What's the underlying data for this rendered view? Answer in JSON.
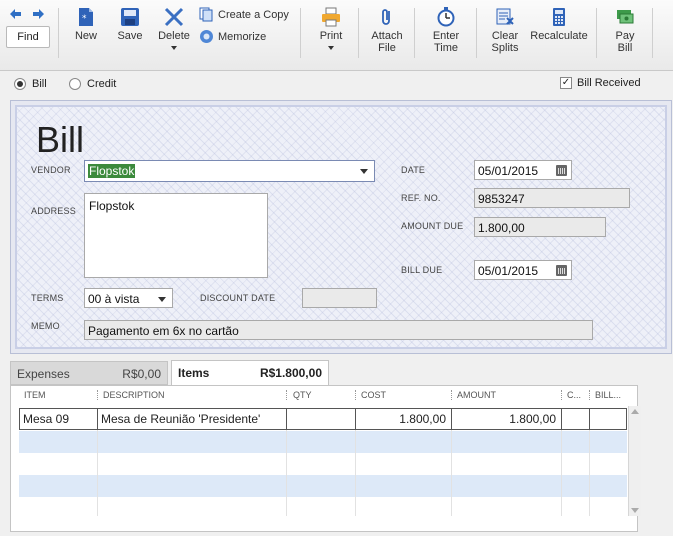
{
  "toolbar": {
    "find": "Find",
    "new": "New",
    "save": "Save",
    "delete": "Delete",
    "create_copy": "Create a Copy",
    "memorize": "Memorize",
    "print": "Print",
    "attach_file": [
      "Attach",
      "File"
    ],
    "enter_time": [
      "Enter",
      "Time"
    ],
    "clear_splits": [
      "Clear",
      "Splits"
    ],
    "recalculate": "Recalculate",
    "pay_bill": [
      "Pay",
      "Bill"
    ]
  },
  "options": {
    "bill_label": "Bill",
    "credit_label": "Credit",
    "bill_received_label": "Bill Received"
  },
  "form": {
    "title": "Bill",
    "vendor_label": "VENDOR",
    "vendor_value": "Flopstok",
    "address_label": "ADDRESS",
    "address_value": "Flopstok",
    "date_label": "DATE",
    "date_value": "05/01/2015",
    "ref_label": "REF. NO.",
    "ref_value": "9853247",
    "amount_due_label": "AMOUNT DUE",
    "amount_due_value": "1.800,00",
    "bill_due_label": "BILL DUE",
    "bill_due_value": "05/01/2015",
    "terms_label": "TERMS",
    "terms_value": "00 à vista",
    "discount_date_label": "DISCOUNT DATE",
    "discount_date_value": "",
    "memo_label": "MEMO",
    "memo_value": "Pagamento em 6x no cartão"
  },
  "tabs": {
    "expenses_label": "Expenses",
    "expenses_amount": "R$0,00",
    "items_label": "Items",
    "items_amount": "R$1.800,00"
  },
  "grid": {
    "columns": [
      "ITEM",
      "DESCRIPTION",
      "QTY",
      "COST",
      "AMOUNT",
      "C...",
      "BILL..."
    ],
    "rows": [
      {
        "item": "Mesa 09",
        "description": "Mesa de Reunião 'Presidente'",
        "qty": "",
        "cost": "1.800,00",
        "amount": "1.800,00"
      }
    ]
  }
}
